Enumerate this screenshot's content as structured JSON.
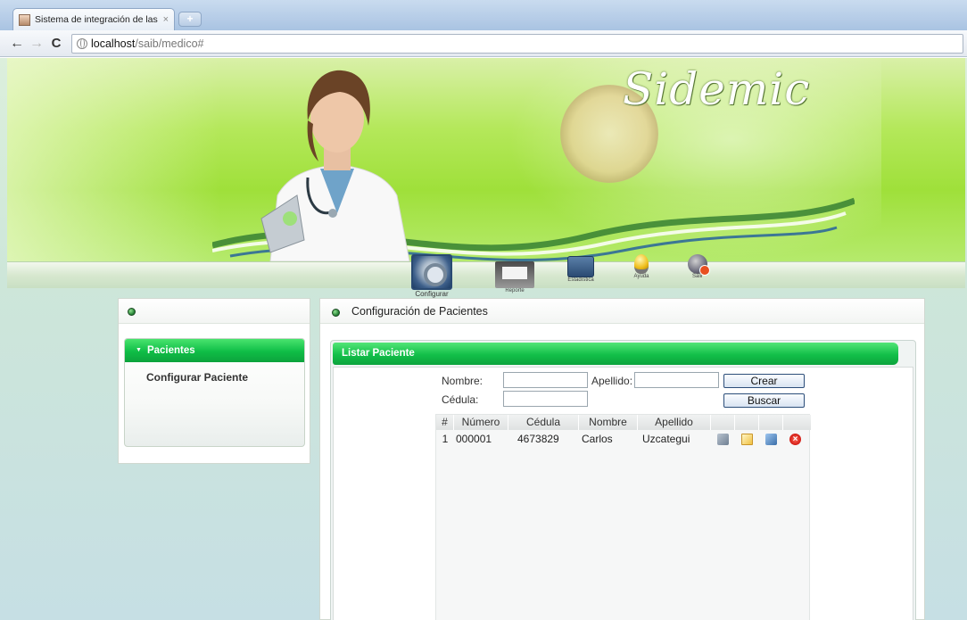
{
  "browser": {
    "tab_title": "Sistema de integración de las e",
    "tab_close": "×",
    "new_tab": "+",
    "nav_back": "←",
    "nav_forward": "→",
    "nav_reload": "C",
    "url_host": "localhost",
    "url_path": "/saib/medico#"
  },
  "banner": {
    "logo": "Sidemic"
  },
  "menu": {
    "items": [
      {
        "label": "Configurar",
        "icon": "gear-config-icon"
      },
      {
        "label": "Reporte",
        "icon": "report-printer-icon"
      },
      {
        "label": "Estadística",
        "icon": "statistics-icon"
      },
      {
        "label": "Ayuda",
        "icon": "lightbulb-help-icon"
      },
      {
        "label": "Salir",
        "icon": "logout-icon"
      }
    ]
  },
  "sidebar": {
    "section": "Pacientes",
    "items": [
      {
        "label": "Configurar Paciente"
      }
    ]
  },
  "main": {
    "title": "Configuración de Pacientes",
    "panel_title": "Listar Paciente",
    "form": {
      "nombre_label": "Nombre:",
      "nombre_value": "",
      "apellido_label": "Apellido:",
      "apellido_value": "",
      "cedula_label": "Cédula:",
      "cedula_value": "",
      "crear_label": "Crear",
      "buscar_label": "Buscar"
    },
    "table": {
      "columns": [
        "#",
        "Número",
        "Cédula",
        "Nombre",
        "Apellido",
        "",
        "",
        "",
        ""
      ],
      "rows": [
        {
          "n": "1",
          "numero": "000001",
          "cedula": "4673829",
          "nombre": "Carlos",
          "apellido": "Uzcategui"
        }
      ]
    }
  },
  "colors": {
    "accent_green": "#0fbd46",
    "banner_green": "#9fe03a",
    "button_border": "#2c4e7a",
    "delete_red": "#d21b14"
  }
}
